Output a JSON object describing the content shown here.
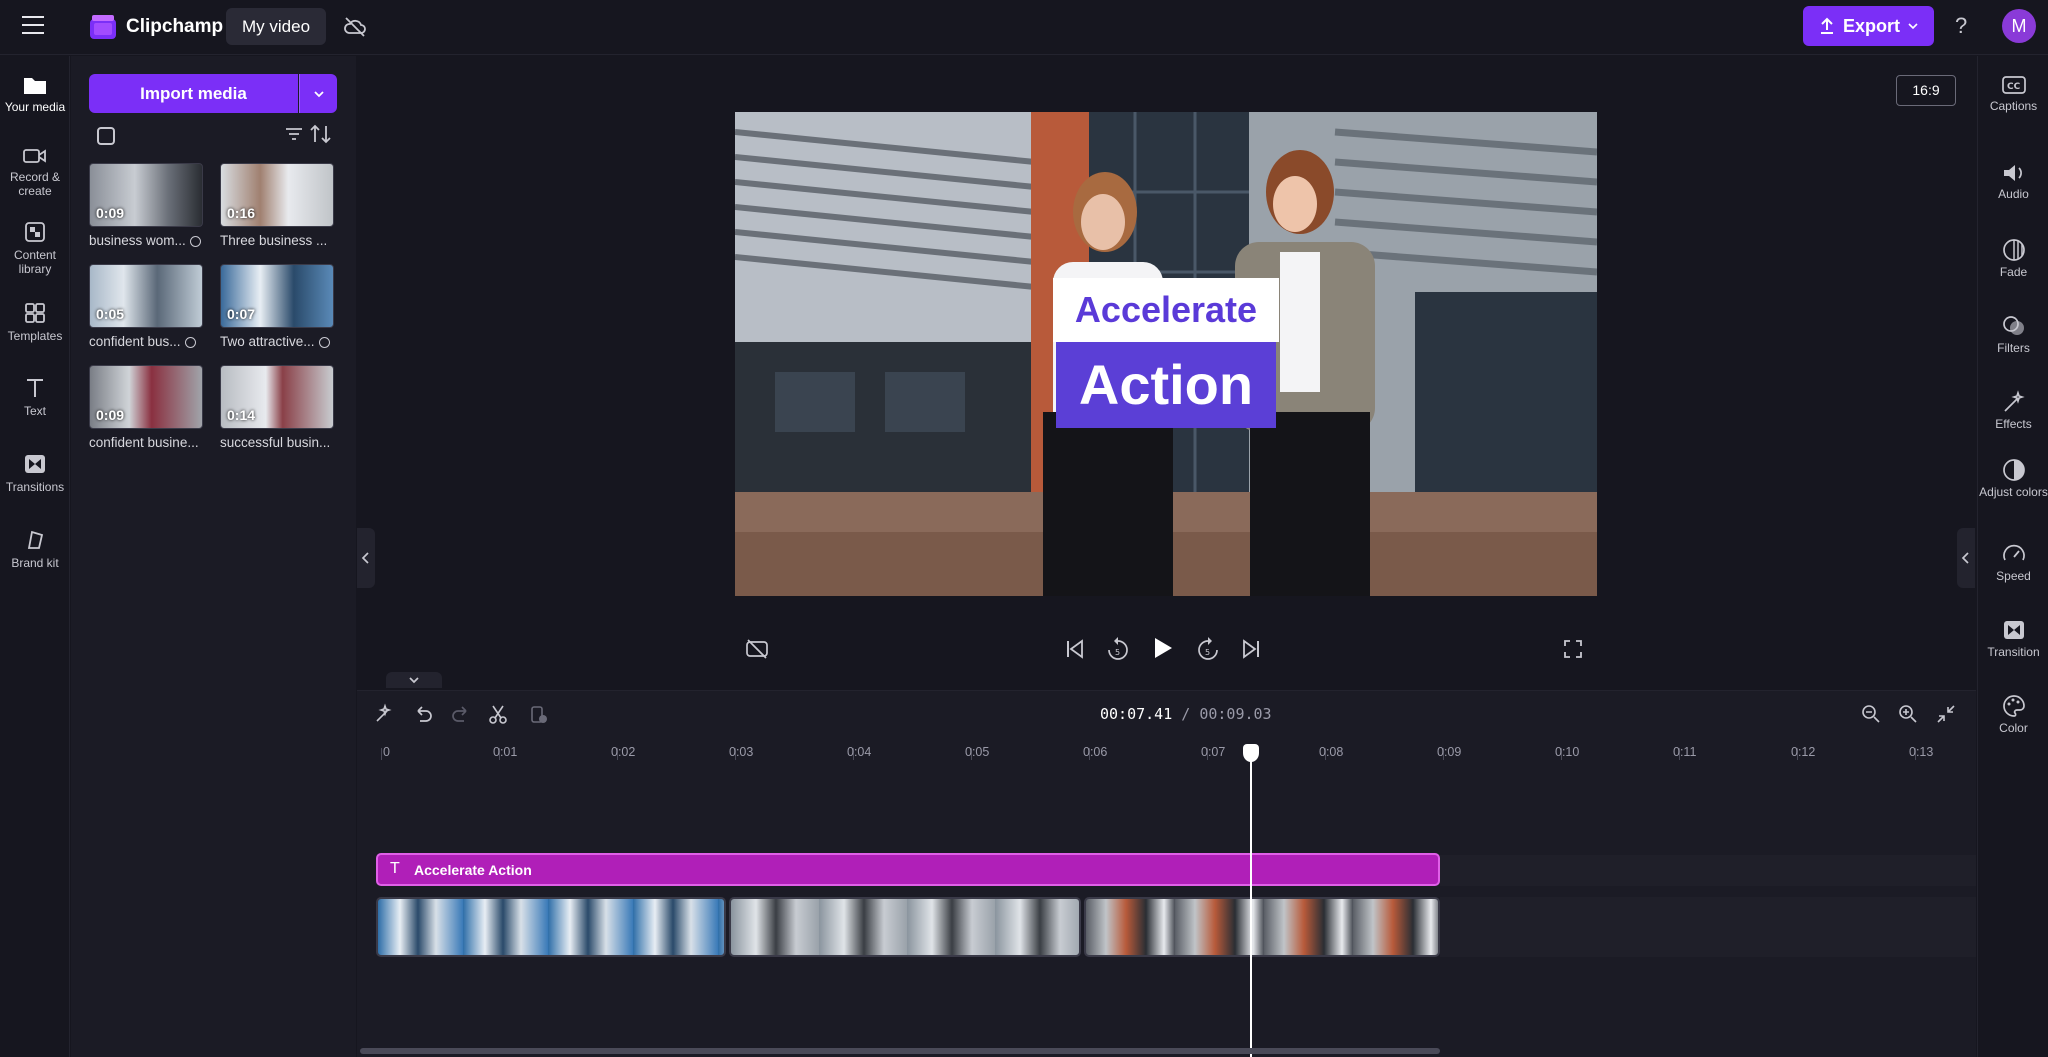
{
  "app": {
    "name": "Clipchamp",
    "project_title": "My video",
    "export_label": "Export",
    "avatar_initial": "M",
    "help_label": "?"
  },
  "left_nav": [
    {
      "label": "Your media",
      "icon": "folder-icon",
      "active": true
    },
    {
      "label": "Record & create",
      "icon": "camera-icon"
    },
    {
      "label": "Content library",
      "icon": "library-icon"
    },
    {
      "label": "Templates",
      "icon": "templates-icon"
    },
    {
      "label": "Text",
      "icon": "text-icon"
    },
    {
      "label": "Transitions",
      "icon": "transitions-icon"
    },
    {
      "label": "Brand kit",
      "icon": "brand-kit-icon"
    }
  ],
  "media": {
    "import_label": "Import media",
    "items": [
      {
        "duration": "0:09",
        "label": "business wom...",
        "checked": true
      },
      {
        "duration": "0:16",
        "label": "Three business ...",
        "checked": false
      },
      {
        "duration": "0:05",
        "label": "confident bus...",
        "checked": true
      },
      {
        "duration": "0:07",
        "label": "Two attractive...",
        "checked": true
      },
      {
        "duration": "0:09",
        "label": "confident busine...",
        "checked": false
      },
      {
        "duration": "0:14",
        "label": "successful busin...",
        "checked": false
      }
    ]
  },
  "preview": {
    "aspect_ratio": "16:9",
    "title_line1": "Accelerate",
    "title_line2": "Action"
  },
  "timeline": {
    "current_time": "00:07.41",
    "total_time": "/ 00:09.03",
    "ruler": [
      "0",
      "0:01",
      "0:02",
      "0:03",
      "0:04",
      "0:05",
      "0:06",
      "0:07",
      "0:08",
      "0:09",
      "0:10",
      "0:11",
      "0:12",
      "0:13"
    ],
    "text_clip_label": "Accelerate Action",
    "playhead_seconds": 7.41
  },
  "right_nav": [
    {
      "label": "Captions",
      "icon": "captions-icon"
    },
    {
      "label": "Audio",
      "icon": "speaker-icon"
    },
    {
      "label": "Fade",
      "icon": "fade-icon"
    },
    {
      "label": "Filters",
      "icon": "filters-icon"
    },
    {
      "label": "Effects",
      "icon": "effects-icon"
    },
    {
      "label": "Adjust colors",
      "icon": "adjust-colors-icon"
    },
    {
      "label": "Speed",
      "icon": "speed-icon"
    },
    {
      "label": "Transition",
      "icon": "transition-icon"
    },
    {
      "label": "Color",
      "icon": "palette-icon"
    }
  ],
  "colors": {
    "accent": "#7b2ff7",
    "text_clip": "#b01fb8",
    "title_purple": "#5b3fd6"
  }
}
